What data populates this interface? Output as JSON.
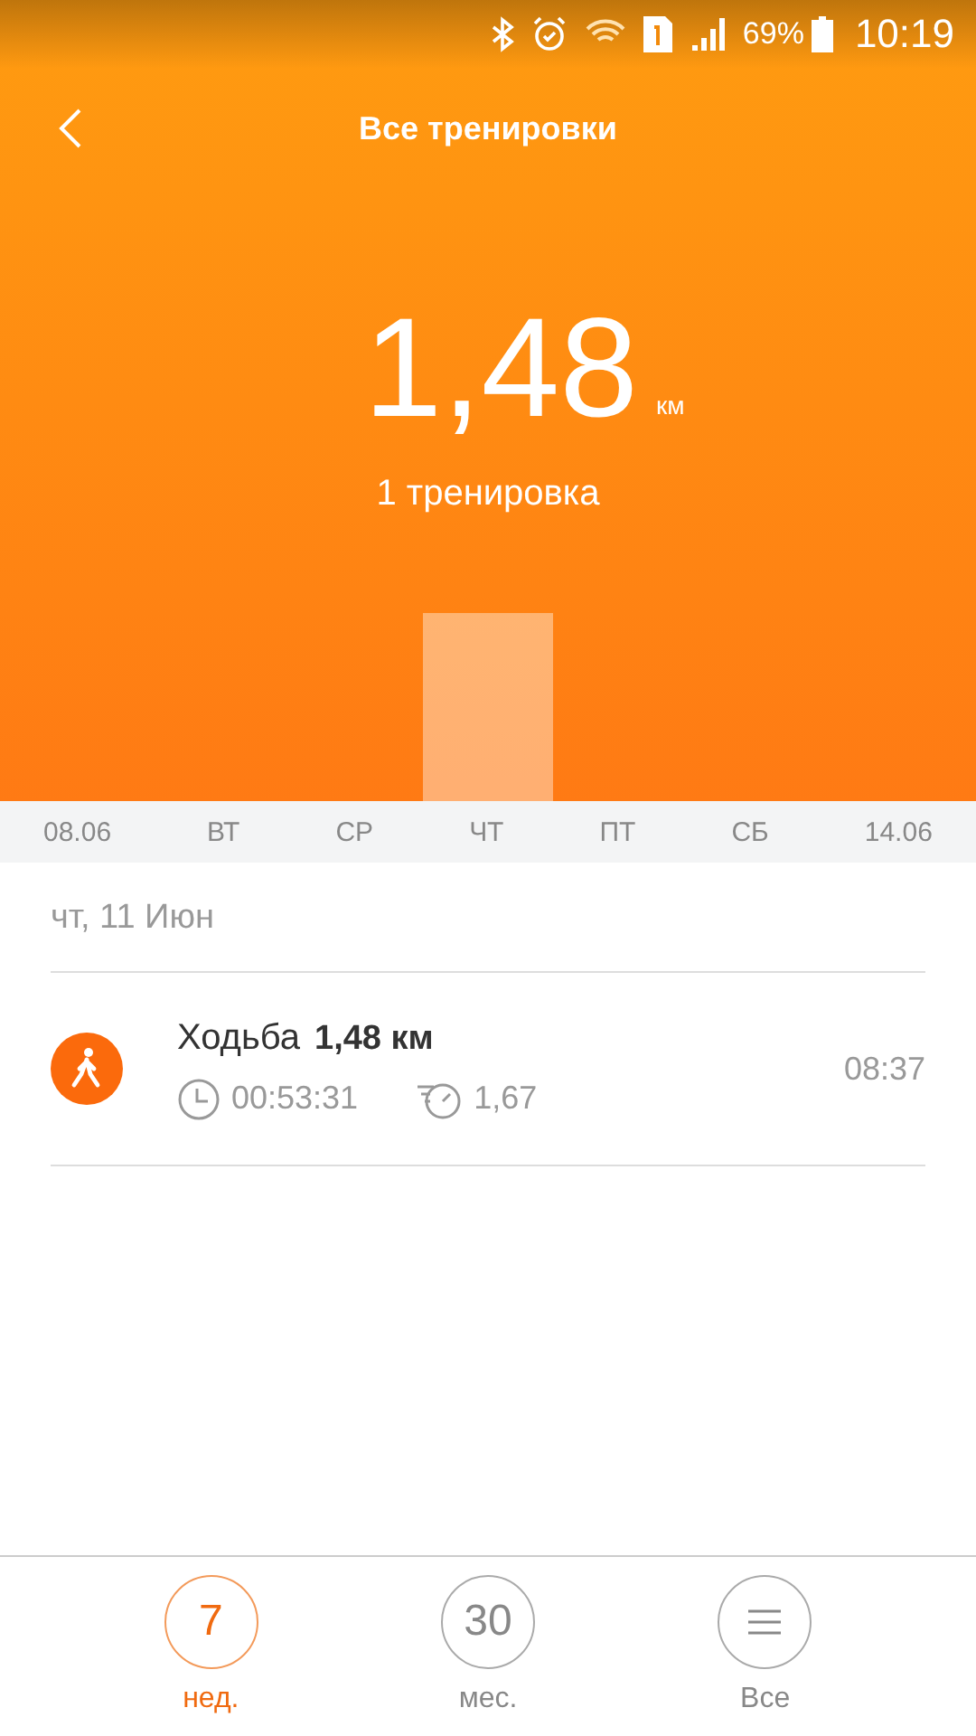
{
  "status_bar": {
    "battery": "69%",
    "time": "10:19"
  },
  "header": {
    "title": "Все тренировки",
    "distance": "1,48",
    "unit": "км",
    "count": "1 тренировка"
  },
  "days": [
    "08.06",
    "ВТ",
    "СР",
    "ЧТ",
    "ПТ",
    "СБ",
    "14.06"
  ],
  "date_heading": "чт, 11 Июн",
  "workouts": [
    {
      "name": "Ходьба",
      "distance": "1,48 км",
      "duration": "00:53:31",
      "pace": "1,67",
      "time": "08:37"
    }
  ],
  "tabs": [
    {
      "kind": "number",
      "value": "7",
      "label": "нед.",
      "selected": true
    },
    {
      "kind": "number",
      "value": "30",
      "label": "мес.",
      "selected": false
    },
    {
      "kind": "icon",
      "label": "Все",
      "selected": false
    }
  ]
}
